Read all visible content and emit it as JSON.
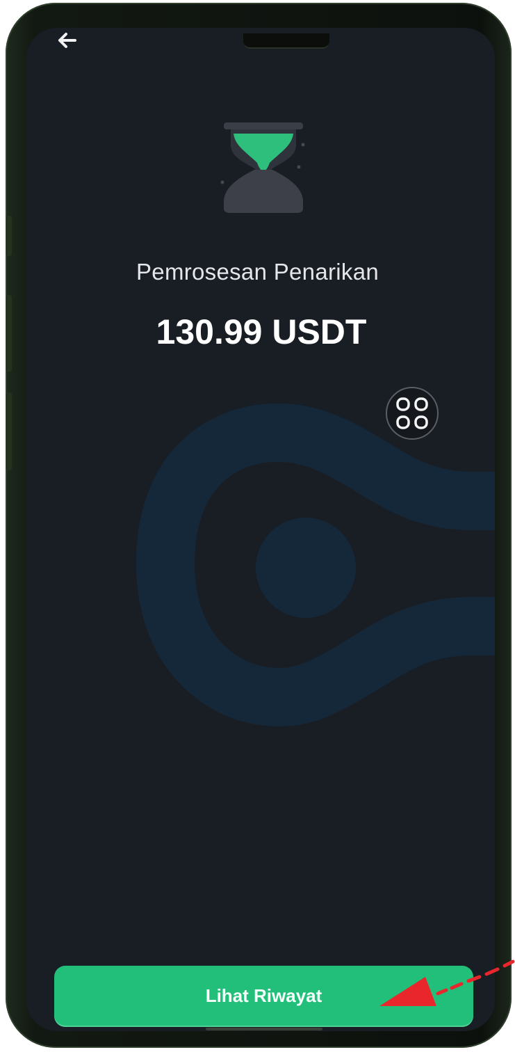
{
  "screen": {
    "title": "Pemrosesan Penarikan",
    "amount": "130.99 USDT",
    "primary_button_label": "Lihat Riwayat"
  },
  "icons": {
    "back": "arrow-left-icon",
    "status": "hourglass-icon",
    "apps": "grid-apps-icon",
    "annotation": "red-dashed-arrow"
  },
  "colors": {
    "background": "#191d24",
    "accent": "#22bf7b",
    "annotation": "#e8262b"
  }
}
